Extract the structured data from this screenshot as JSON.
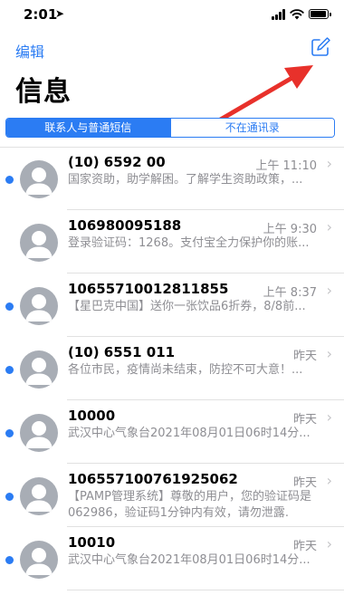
{
  "status_bar": {
    "time": "2:01",
    "location_arrow": "➤"
  },
  "nav": {
    "edit_label": "编辑",
    "compose_icon": "compose-icon"
  },
  "page_title": "信息",
  "filter_tabs": [
    {
      "label": "联系人与普通短信",
      "selected": true
    },
    {
      "label": "不在通讯录",
      "selected": false
    }
  ],
  "colors": {
    "accent": "#2b7cf3",
    "annotation_arrow": "#e8312b",
    "secondary_text": "#8e8e93"
  },
  "messages": [
    {
      "sender": "(10) 6592 00",
      "time": "上午 11:10",
      "preview": "国家资助，助学解困。了解学生资助政策，...",
      "unread": true
    },
    {
      "sender": "106980095188",
      "time": "上午 9:30",
      "preview": "登录验证码：1268。支付宝全力保护你的账...",
      "unread": false
    },
    {
      "sender": "10655710012811855",
      "time": "上午 8:37",
      "preview": "【星巴克中国】送你一张饮品6折券，8/8前...",
      "unread": true
    },
    {
      "sender": "(10) 6551 011",
      "time": "昨天",
      "preview": "各位市民，疫情尚未结束，防控不可大意！...",
      "unread": true
    },
    {
      "sender": "10000",
      "time": "昨天",
      "preview": "武汉中心气象台2021年08月01日06时14分...",
      "unread": true
    },
    {
      "sender": "106557100761925062",
      "time": "昨天",
      "preview": "【PAMP管理系统】尊敬的用户，您的验证码是062986，验证码1分钟内有效，请勿泄露.",
      "unread": true
    },
    {
      "sender": "10010",
      "time": "昨天",
      "preview": "武汉中心气象台2021年08月01日06时14分...",
      "unread": true
    }
  ]
}
